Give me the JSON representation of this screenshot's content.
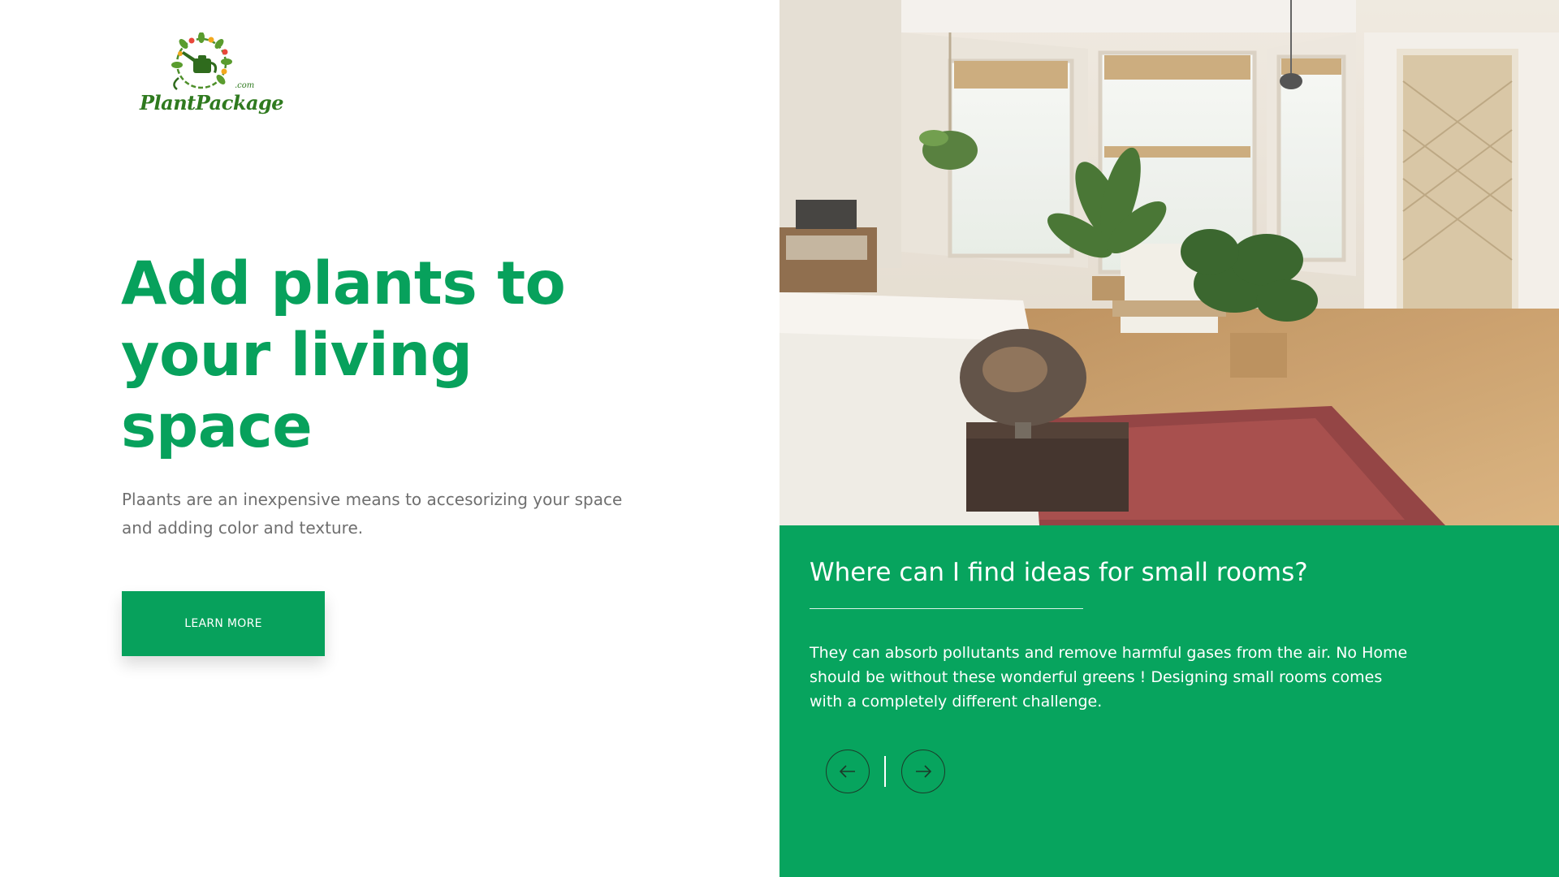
{
  "brand": {
    "logo_word": "PlantPackage",
    "logo_suffix": ".com",
    "icon": "watering-can-wreath-logo"
  },
  "hero": {
    "title": "Add plants to your living space",
    "subtitle": "Plaants are an inexpensive means to accesorizing your space and adding color and texture.",
    "cta_label": "LEARN MORE"
  },
  "feature": {
    "title": "Where can I find ideas for small rooms?",
    "body": "They can absorb pollutants and remove harmful gases from the air. No Home should be without these wonderful greens ! Designing small rooms comes with a completely different challenge.",
    "prev_icon": "arrow-left-icon",
    "next_icon": "arrow-right-icon"
  },
  "colors": {
    "accent": "#07a15c",
    "panel": "#07a45e",
    "body_text": "#6f6f6f",
    "logo_green": "#2f7a1f"
  }
}
